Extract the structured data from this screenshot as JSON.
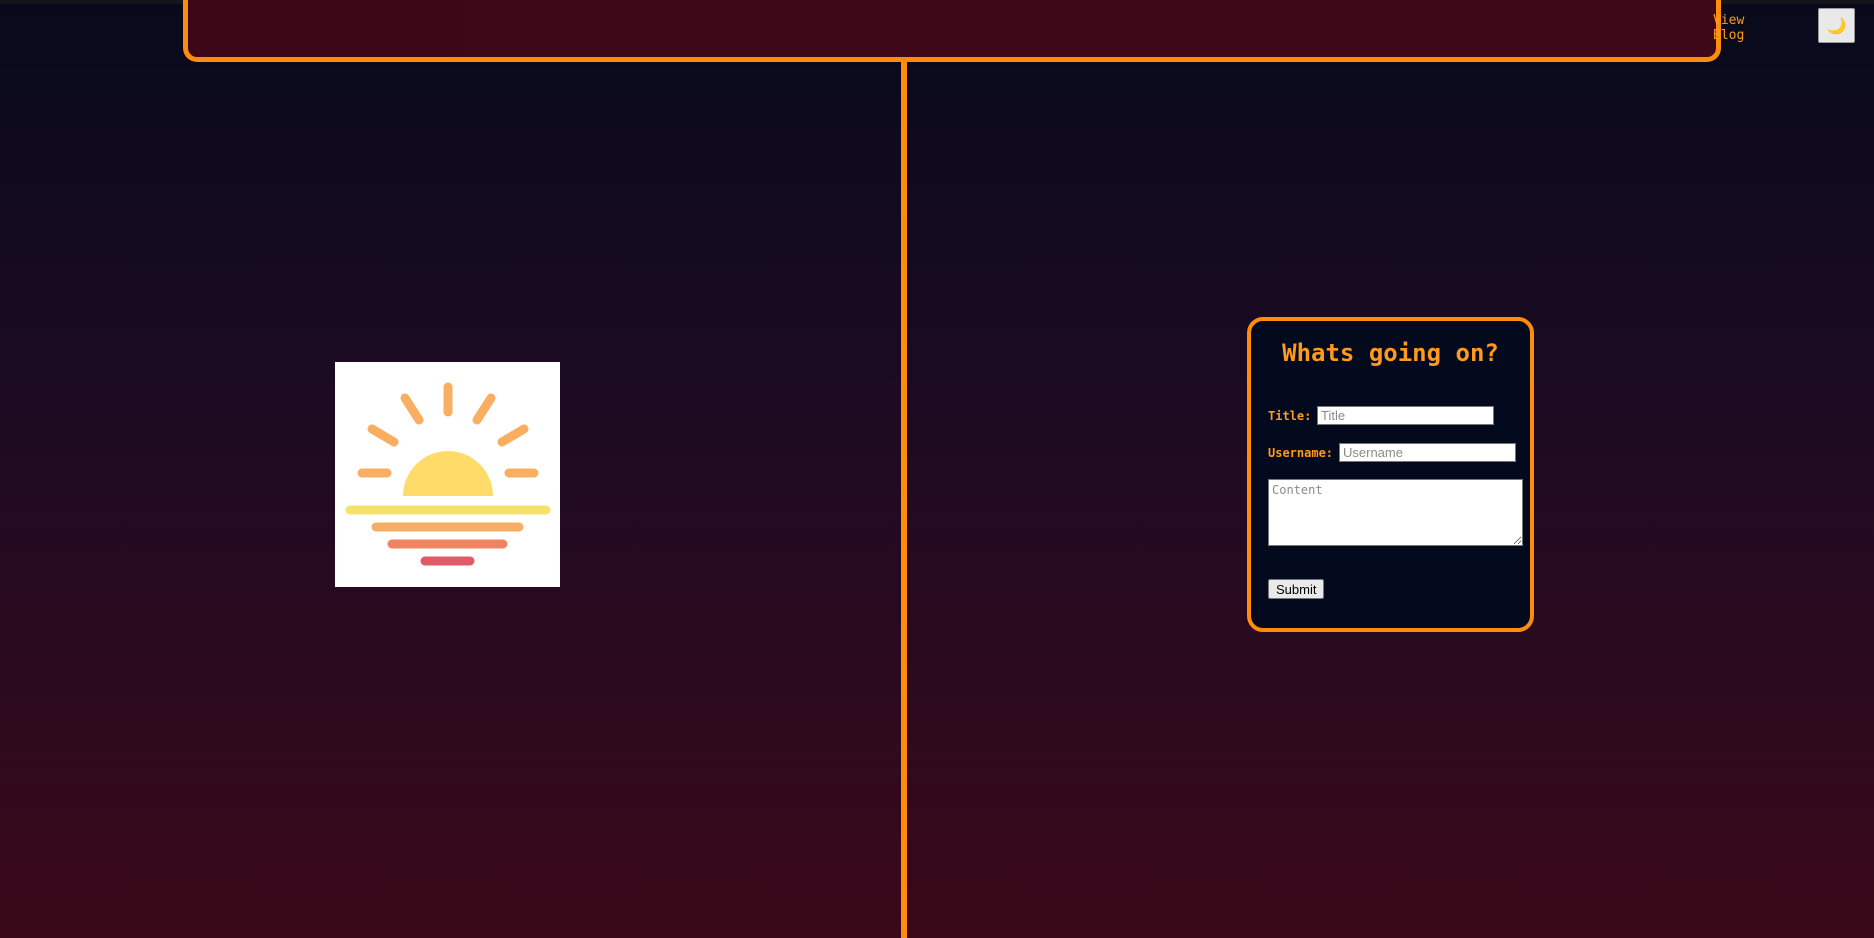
{
  "header": {
    "nav_link": "View Blog",
    "theme_toggle_icon": "moon-icon",
    "theme_toggle_glyph": "🌙"
  },
  "logo": {
    "icon": "sunrise-icon",
    "colors": {
      "sun": "#ffdc6a",
      "rays": "#f9ae62",
      "line1": "#f5e26b",
      "line2": "#f6ae64",
      "line3": "#ee8462",
      "line4": "#e05a68"
    }
  },
  "form": {
    "title": "Whats going on?",
    "title_label": "Title:",
    "title_placeholder": "Title",
    "username_label": "Username:",
    "username_placeholder": "Username",
    "content_placeholder": "Content",
    "submit_label": "Submit"
  },
  "colors": {
    "accent": "#ff8c0a",
    "header_bg": "#3c0818",
    "card_bg": "#040a1e"
  }
}
